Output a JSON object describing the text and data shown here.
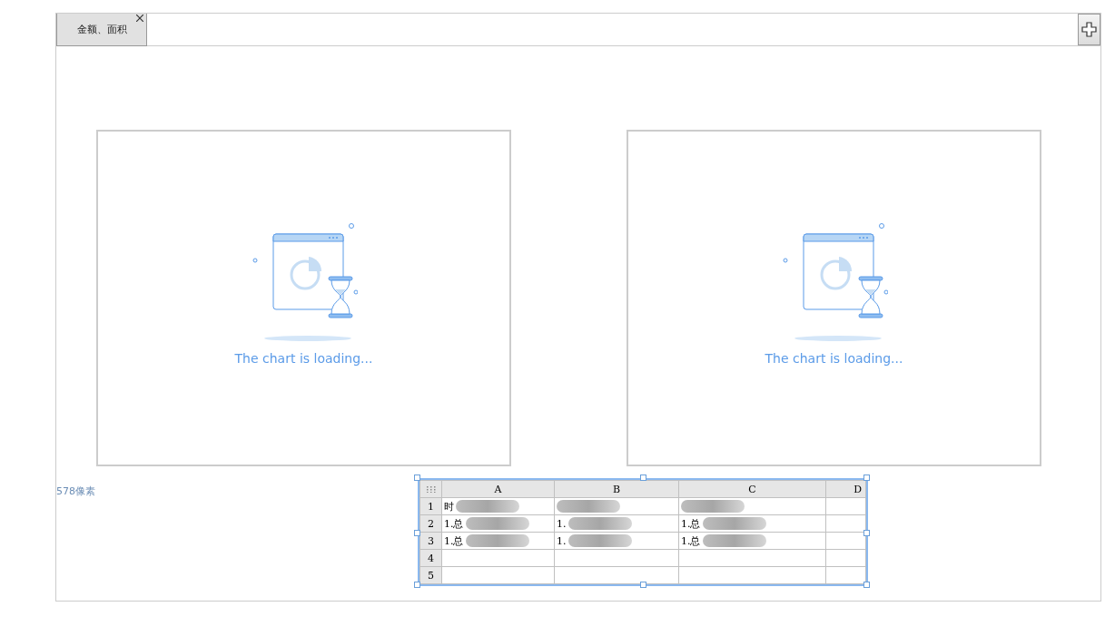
{
  "tabs": [
    {
      "label": "金额、面积",
      "selected": true
    }
  ],
  "charts": [
    {
      "message": "The chart is loading..."
    },
    {
      "message": "The chart is loading..."
    }
  ],
  "size_label": "578像素",
  "sheet": {
    "selected": true,
    "columns": [
      "A",
      "B",
      "C",
      "D"
    ],
    "rows": [
      {
        "header": "1",
        "cells": [
          "时",
          "",
          "",
          ""
        ],
        "blurred": true
      },
      {
        "header": "2",
        "cells": [
          "1.总",
          "1.",
          "1.总",
          ""
        ],
        "blurred": true
      },
      {
        "header": "3",
        "cells": [
          "1.总",
          "1.",
          "1.总",
          ""
        ],
        "blurred": true
      },
      {
        "header": "4",
        "cells": [
          "",
          "",
          "",
          ""
        ],
        "blurred": false
      },
      {
        "header": "5",
        "cells": [
          "",
          "",
          "",
          ""
        ],
        "blurred": false
      }
    ]
  }
}
